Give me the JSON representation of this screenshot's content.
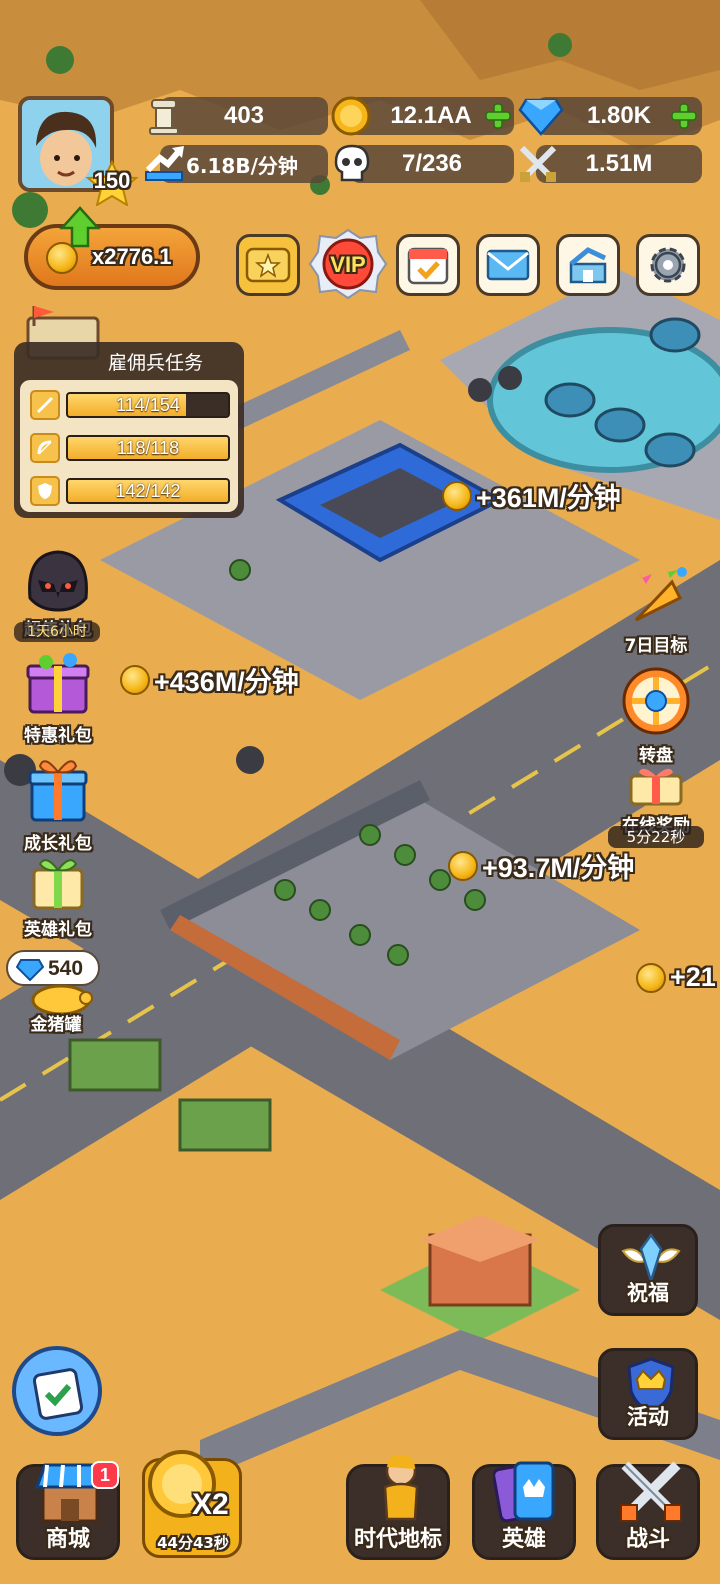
{
  "resources": {
    "trophies": "403",
    "gold": "12.1AA",
    "gems": "1.80K",
    "income_rate": "6.18B/分钟",
    "population": "7/236",
    "power": "1.51M"
  },
  "player": {
    "level": "150"
  },
  "multiplier": {
    "label": "x2776.1"
  },
  "top_buttons": {
    "vip_label": "VIP"
  },
  "quest": {
    "title": "雇佣兵任务",
    "rows": [
      {
        "text": "114/154",
        "progress": 0.74
      },
      {
        "text": "118/118",
        "progress": 1.0
      },
      {
        "text": "142/142",
        "progress": 1.0
      }
    ]
  },
  "left_side": {
    "super_pack": "超值礼包",
    "super_pack_timer": "1天6小时",
    "discount_pack": "特惠礼包",
    "growth_pack": "成长礼包",
    "hero_pack": "英雄礼包",
    "piggy_gems": "540",
    "piggy_bank": "金猪罐"
  },
  "right_side": {
    "seven_day": "7日目标",
    "wheel": "转盘",
    "online_reward": "在线奖励",
    "online_timer": "5分22秒",
    "blessing": "祝福",
    "events": "活动"
  },
  "income_labels": {
    "a": "+361M/分钟",
    "b": "+436M/分钟",
    "c": "+93.7M/分钟",
    "d": "+21"
  },
  "bottom_bar": {
    "shop": "商城",
    "shop_badge": "1",
    "boost_multiplier": "X2",
    "boost_timer": "44分43秒",
    "era_landmark": "时代地标",
    "heroes": "英雄",
    "battle": "战斗"
  },
  "colors": {
    "ground": "#e7a94a",
    "road": "#6f6f78",
    "accent_gold": "#f5b516",
    "gem_blue": "#3aa7ff",
    "plus_green": "#5fcf2f"
  }
}
